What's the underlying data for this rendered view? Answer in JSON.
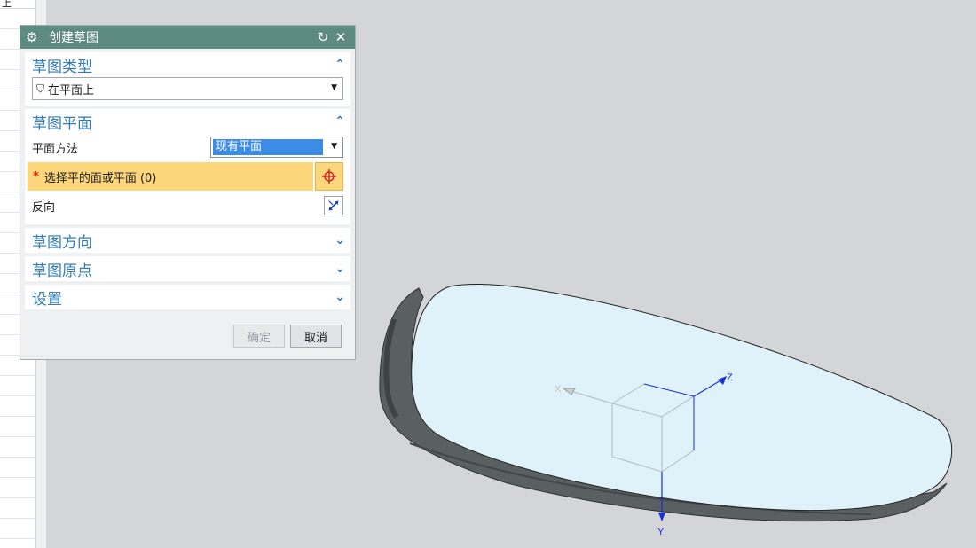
{
  "navigator": {
    "first_cell_text": "上"
  },
  "dialog": {
    "title": "创建草图",
    "icons": {
      "settings": "gear-icon",
      "reset": "reset-icon",
      "close": "close-icon"
    },
    "sections": {
      "sketch_type": {
        "title": "草图类型",
        "value": "在平面上"
      },
      "sketch_plane": {
        "title": "草图平面",
        "plane_method_label": "平面方法",
        "plane_method_value": "现有平面",
        "select_prompt": "选择平的面或平面 (0)",
        "required_mark": "*",
        "reverse_label": "反向"
      },
      "sketch_orientation": {
        "title": "草图方向"
      },
      "sketch_origin": {
        "title": "草图原点"
      },
      "settings": {
        "title": "设置"
      }
    },
    "buttons": {
      "ok": "确定",
      "cancel": "取消"
    }
  },
  "viewport": {
    "axes": {
      "x": "X",
      "y": "Y",
      "z": "Z"
    },
    "colors": {
      "face": "#dff2f9",
      "body": "#5a6062",
      "axis": "#1a2fd6"
    }
  }
}
